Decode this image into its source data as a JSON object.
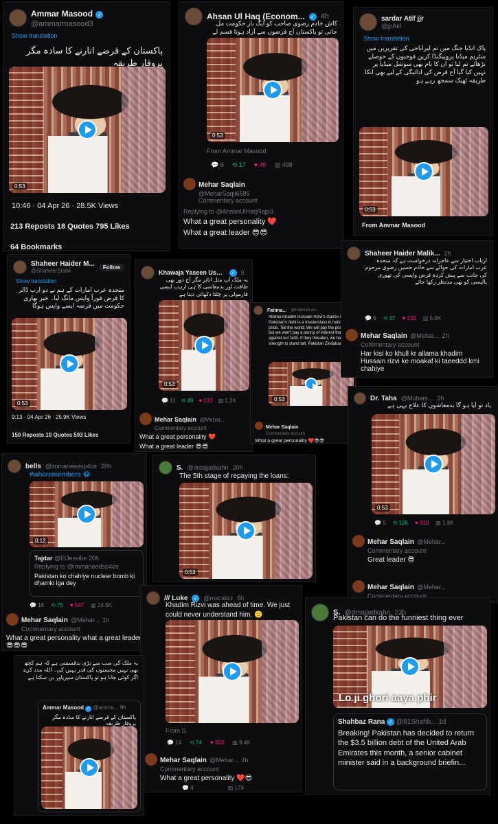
{
  "colors": {
    "accent": "#1d9bf0",
    "retweet": "#00ba7c",
    "like": "#f91880",
    "background": "#000000"
  },
  "icons": [
    "verified-icon",
    "play-icon",
    "reply-icon",
    "retweet-icon",
    "like-icon",
    "views-icon",
    "share-icon",
    "bookmark-icon"
  ],
  "c1": {
    "name": "Ammar Masood",
    "handle": "@ammarmasood3",
    "translate": "Show translation",
    "text": "پاکستان کے قرضے اتارنے کا سادہ مگر پروقار طریقہ",
    "dur": "0:53",
    "meta": "10:46 · 04 Apr 26 · 28.5K Views",
    "stats": "213 Reposts   18 Quotes   795 Likes",
    "bookmarks": "64 Bookmarks"
  },
  "c2": {
    "name": "Ahsan Ul Haq (Econom...",
    "time": "4h",
    "text": "کاش خادم رضوی صاحب کو ایک بار حکومت مل جاتی تو پاکستان آج قرضوں سے آزاد ہوتا قسم لے",
    "dur": "0:53",
    "from": "From Ammar Masood",
    "s_reply": "6",
    "s_rt": "17",
    "s_like": "40",
    "s_views": "498",
    "r_name": "Mehar Saqlain",
    "r_handle": "@MeharSaqli6585",
    "r_sub": "Commentary account",
    "r_to": "Replying to @AhsanUlHaqRajp3",
    "r_text1": "What a great personality ❤️",
    "r_text2": "What a great leader 😎😎"
  },
  "c3": {
    "name": "sardar Atif jjr",
    "handle": "@jjrAtif",
    "translate": "Show translation",
    "text": "پاک انڈیا جنگ میں تم لیراباجی کی تقریریں میں سٹریم میڈیا پروپیگنڈا کریں فوجیوں کے حوصلے بڑھائے تم لیا تو ان کا نام بھی سوشل میڈیا پر نہیں کیا گیا آج قرض کی ادائیگی کے لیے بھی انکا طریقہ ٹھیک سمجھ رہے ہو",
    "dur": "0:53",
    "from": "From Ammar Masood"
  },
  "c4": {
    "name": "Shaheer Haider M...",
    "handle": "@ShaheerSiaIvi",
    "follow": "Follow",
    "translate": "Show translation",
    "text": "متحدہ عرب امارات کے ہم نے دو ارب ڈالر کا قرض فوراً واپس مانگ لیا۔ خیر بھاری حکومت میں قرضہ ایسے واپس ہوگا",
    "dur": "0:53",
    "meta": "9:13 · 04 Apr 26 · 25.9K Views",
    "stats": "150 Reposts   10 Quotes   593 Likes"
  },
  "c5": {
    "name": "Khawaja Yaseen Usmani",
    "time": "9h",
    "text": "یہ ملک آپ مثل اتاتر مگر آج دور بھی طاقت اور بدمعاشی کا ہی ارہب ایسی فارمولی پر چلتا دکھائی دیتا ہے",
    "dur": "0:53",
    "s_reply": "11",
    "s_rt": "49",
    "s_like": "122",
    "s_views": "1.2K",
    "r_name": "Mehar Saqlain",
    "r_handle": "@Mehar...",
    "r_sub": "Commentary account",
    "r_text1": "What a great personality ❤️",
    "r_text2": "What a great leader 😎😎"
  },
  "c6": {
    "name": "Fatima...",
    "handle": "@Fatimah-ali...",
    "text": "Allama Khadim Hussain Rizvi's stance on Pakistan's debt is a masterclass in national pride. Tell the world: We will pay the principal, but we won't pay a penny of interest that goes against our faith. If they threaten, we have the strength to stand tall. Pakistan Zindabad 🔥",
    "dur": "0:53",
    "r_name": "Mehar Saqlain",
    "r_sub": "Commentary account",
    "r_text1": "What a great personality ❤️😎😎"
  },
  "c7": {
    "name": "Shaheer Haider Malik...",
    "time": "2h",
    "text": "ارباب اختیار سے عاجزانہ درخواست ہے کہ متحدہ عرب امارات کی حوالے سے خادم حسین رضوی مرحوم کی جانب سے پیش کردہ قرض واپسی کی تھوری پالیسی کو بھی مدنظر رکھا جائے",
    "s_reply": "9",
    "s_rt": "37",
    "s_like": "132",
    "s_views": "5.5K",
    "r_name": "Mehar Saqlain",
    "r_handle": "@Mehar...",
    "r_time": "2h",
    "r_sub": "Commentary account",
    "r_text1": "Har kisi ko khull kr allama khadim Hussain rizvi ke moakaf ki taeeddd kmi chahiye"
  },
  "c8": {
    "name": "Dr. Taha",
    "handle": "@Muham...",
    "time": "2h",
    "text": "یاد تو آیا ہو گا بدمعاشوں کا علاج یہی ہے",
    "dur": "0:53",
    "s_reply": "5",
    "s_rt": "126",
    "s_like": "310",
    "s_views": "1.8K",
    "r_name": "Mehar Saqlain",
    "r_handle": "@Mehar...",
    "r_sub": "Commentary account",
    "r_text1": "Great leader 😎",
    "r2_name": "Mehar Saqlain",
    "r2_handle": "@Mehar...",
    "r2_sub": "Commentary account"
  },
  "c9": {
    "name": "bells",
    "handle": "@immaneedsp4ce",
    "time": "20h",
    "hashtag": "#whoremembers 😂",
    "dur": "0:12",
    "q_name": "Tajdar",
    "q_handle": "@ElJesvibe",
    "q_time": "20h",
    "q_to": "Replying to @immaneedsp4ce",
    "q_text": "Pakistan ko chahiye nuclear bomb ki dhamki lga dey",
    "s_reply": "16",
    "s_rt": "75",
    "s_like": "547",
    "s_views": "24.5K",
    "r_name": "Mehar Saqlain",
    "r_handle": "@Mehar...",
    "r_time": "1h",
    "r_sub": "Commentary account",
    "r_text1": "What a great personality what a great leader 😎😎😎"
  },
  "c10": {
    "name": "S.",
    "handle": "@drsajjadkahn",
    "time": "20h",
    "text": "The 5th stage of repaying the loans:",
    "dur": "0:53"
  },
  "c11": {
    "name": "/// Luke",
    "handle": "@mxcaltrz",
    "time": "6h",
    "text": "Khadim Rizvi was ahead of time. We just could never understand him. 🙂",
    "from": "From S.",
    "s_reply": "14",
    "s_rt": "74",
    "s_like": "303",
    "s_views": "9.4K",
    "r_name": "Mehar Saqlain",
    "r_handle": "@Mehar...",
    "r_time": "4h",
    "r_sub": "Commentary account",
    "r_text1": "What a great personality ❤️😎",
    "r_reply": "4",
    "r_views": "179"
  },
  "c12": {
    "name": "S.",
    "handle": "@drsajjadkahn",
    "time": "23h",
    "text": "Pakistan can do the funniest thing ever",
    "caption": "Lo ji ghori aaya phir",
    "q_name": "Shahbaz Rana",
    "q_handle": "@81Shahb...",
    "q_time": "1d",
    "q_text": "Breaking! Pakistan has decided to return the $3.5 billion debt of the United Arab Emirates this month, a senior cabinet minister said in a background briefin..."
  },
  "c13": {
    "text": "یہ ملک کی سب سے بڑی بدقسمتی ہے کہ ہم کچھ بھی نہیں محسنوں کی قدر نہیں کی۔ اللہ مدد کرے اگر کوئی جانا ہو تو پاکستان سپرپاور بن سکتا ہے",
    "q_name": "Ammar Masood",
    "q_handle": "@amma...",
    "q_time": "9h",
    "q_text": "پاکستان کے قرضے اتارنے کا سادہ مگر پروقار طریقہ"
  }
}
